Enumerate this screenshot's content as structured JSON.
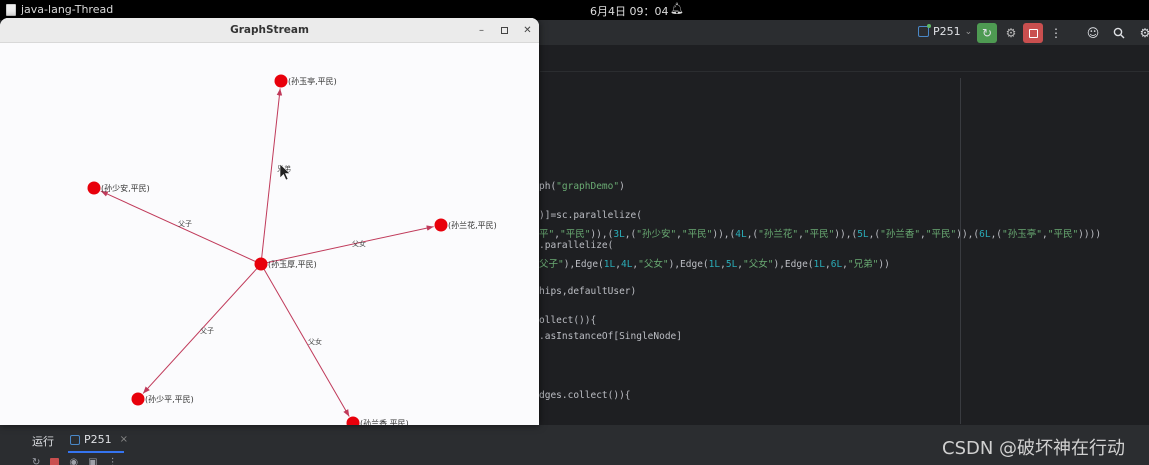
{
  "system_bar": {
    "app_name": "java-lang-Thread",
    "clock": "6月4日  09：04",
    "bell_icon": "bell-icon"
  },
  "ide_toolbar": {
    "run_config": "P251"
  },
  "graph_window": {
    "title": "GraphStream",
    "node_color": "#e8000b",
    "edge_color": "#c03a5a",
    "nodes": [
      {
        "id": "1",
        "label": "(孙玉厚,平民)"
      },
      {
        "id": "2",
        "label": "(孙少平,平民)"
      },
      {
        "id": "3",
        "label": "(孙少安,平民)"
      },
      {
        "id": "4",
        "label": "(孙兰花,平民)"
      },
      {
        "id": "5",
        "label": "(孙兰香,平民)"
      },
      {
        "id": "6",
        "label": "(孙玉亭,平民)"
      }
    ],
    "edges": [
      {
        "from": "1",
        "to": "6",
        "label": "兄弟"
      },
      {
        "from": "1",
        "to": "3",
        "label": "父子"
      },
      {
        "from": "1",
        "to": "4",
        "label": "父女"
      },
      {
        "from": "1",
        "to": "2",
        "label": "父子"
      },
      {
        "from": "1",
        "to": "5",
        "label": "父女"
      }
    ]
  },
  "code": [
    {
      "segments": [
        {
          "t": "ph(",
          "c": ""
        },
        {
          "t": "\"graphDemo\"",
          "c": "str"
        },
        {
          "t": ")",
          "c": ""
        }
      ]
    },
    {
      "segments": [
        {
          "t": ")]=sc.parallelize(",
          "c": ""
        }
      ]
    },
    {
      "segments": [
        {
          "t": "平\"",
          "c": "str"
        },
        {
          "t": ",",
          "c": ""
        },
        {
          "t": "\"平民\"",
          "c": "str"
        },
        {
          "t": ")),(",
          "c": ""
        },
        {
          "t": "3L",
          "c": "num"
        },
        {
          "t": ",(",
          "c": ""
        },
        {
          "t": "\"孙少安\"",
          "c": "str"
        },
        {
          "t": ",",
          "c": ""
        },
        {
          "t": "\"平民\"",
          "c": "str"
        },
        {
          "t": ")),(",
          "c": ""
        },
        {
          "t": "4L",
          "c": "num"
        },
        {
          "t": ",(",
          "c": ""
        },
        {
          "t": "\"孙兰花\"",
          "c": "str"
        },
        {
          "t": ",",
          "c": ""
        },
        {
          "t": "\"平民\"",
          "c": "str"
        },
        {
          "t": ")),(",
          "c": ""
        },
        {
          "t": "5L",
          "c": "num"
        },
        {
          "t": ",(",
          "c": ""
        },
        {
          "t": "\"孙兰香\"",
          "c": "str"
        },
        {
          "t": ",",
          "c": ""
        },
        {
          "t": "\"平民\"",
          "c": "str"
        },
        {
          "t": ")),(",
          "c": ""
        },
        {
          "t": "6L",
          "c": "num"
        },
        {
          "t": ",(",
          "c": ""
        },
        {
          "t": "\"孙玉亭\"",
          "c": "str"
        },
        {
          "t": ",",
          "c": ""
        },
        {
          "t": "\"平民\"",
          "c": "str"
        },
        {
          "t": "))))",
          "c": ""
        }
      ]
    },
    {
      "segments": [
        {
          "t": ".parallelize(",
          "c": ""
        }
      ]
    },
    {
      "segments": [
        {
          "t": "父子\"",
          "c": "str"
        },
        {
          "t": "),Edge(",
          "c": ""
        },
        {
          "t": "1L",
          "c": "num"
        },
        {
          "t": ",",
          "c": ""
        },
        {
          "t": "4L",
          "c": "num"
        },
        {
          "t": ",",
          "c": ""
        },
        {
          "t": "\"父女\"",
          "c": "str"
        },
        {
          "t": "),Edge(",
          "c": ""
        },
        {
          "t": "1L",
          "c": "num"
        },
        {
          "t": ",",
          "c": ""
        },
        {
          "t": "5L",
          "c": "num"
        },
        {
          "t": ",",
          "c": ""
        },
        {
          "t": "\"父女\"",
          "c": "str"
        },
        {
          "t": "),Edge(",
          "c": ""
        },
        {
          "t": "1L",
          "c": "num"
        },
        {
          "t": ",",
          "c": ""
        },
        {
          "t": "6L",
          "c": "num"
        },
        {
          "t": ",",
          "c": ""
        },
        {
          "t": "\"兄弟\"",
          "c": "str"
        },
        {
          "t": "))",
          "c": ""
        }
      ]
    },
    {
      "segments": [
        {
          "t": "hips,defaultUser)",
          "c": ""
        }
      ]
    },
    {
      "segments": [
        {
          "t": "ollect()){",
          "c": ""
        }
      ]
    },
    {
      "segments": [
        {
          "t": ".asInstanceOf[SingleNode]",
          "c": ""
        }
      ]
    },
    {
      "segments": [
        {
          "t": "dges.collect()){",
          "c": ""
        }
      ]
    }
  ],
  "run_panel": {
    "title": "运行",
    "tab_label": "P251",
    "close_glyph": "×"
  },
  "watermark": "CSDN @破坏神在行动"
}
